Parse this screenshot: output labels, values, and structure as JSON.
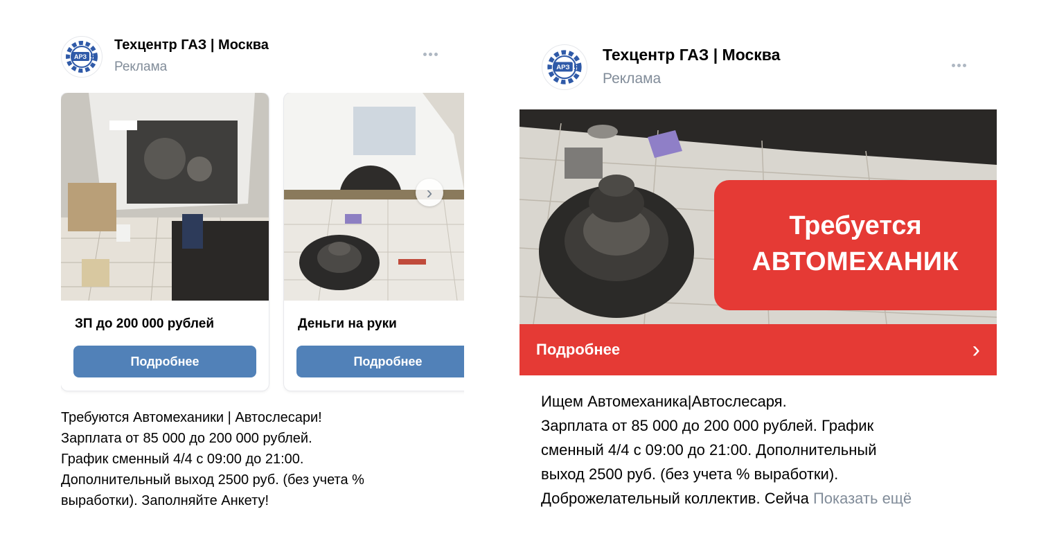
{
  "left_post": {
    "author": "Техцентр ГАЗ | Москва",
    "label": "Реклама",
    "logo_text": "АРЗ",
    "logo_digit": "5",
    "cards": [
      {
        "title": "ЗП до 200 000 рублей",
        "button": "Подробнее"
      },
      {
        "title": "Деньги на руки",
        "button": "Подробнее"
      }
    ],
    "next_icon": "chevron-right-icon",
    "text": "Требуются Автомеханики | Автослесари!\nЗарплата от 85 000 до 200 000 рублей.\nГрафик сменный 4/4 с 09:00 до 21:00.\nДополнительный выход 2500 руб. (без учета %\nвыработки). Заполняйте Анкету!"
  },
  "right_post": {
    "author": "Техцентр ГАЗ | Москва",
    "label": "Реклама",
    "logo_text": "АРЗ",
    "logo_digit": "5",
    "banner_line1": "Требуется",
    "banner_line2": "АВТОМЕХАНИК",
    "cta": "Подробнее",
    "text": "Ищем Автомеханика|Автослесаря.\nЗарплата от 85 000 до 200 000 рублей. График\nсменный 4/4 с 09:00 до 21:00. Дополнительный\nвыход 2500 руб. (без учета % выработки).",
    "text_last": "Доброжелательный коллектив. Сейча",
    "show_more": "Показать ещё"
  },
  "colors": {
    "accent_blue": "#5181b8",
    "cta_red": "#e53a35",
    "muted": "#818c99"
  }
}
